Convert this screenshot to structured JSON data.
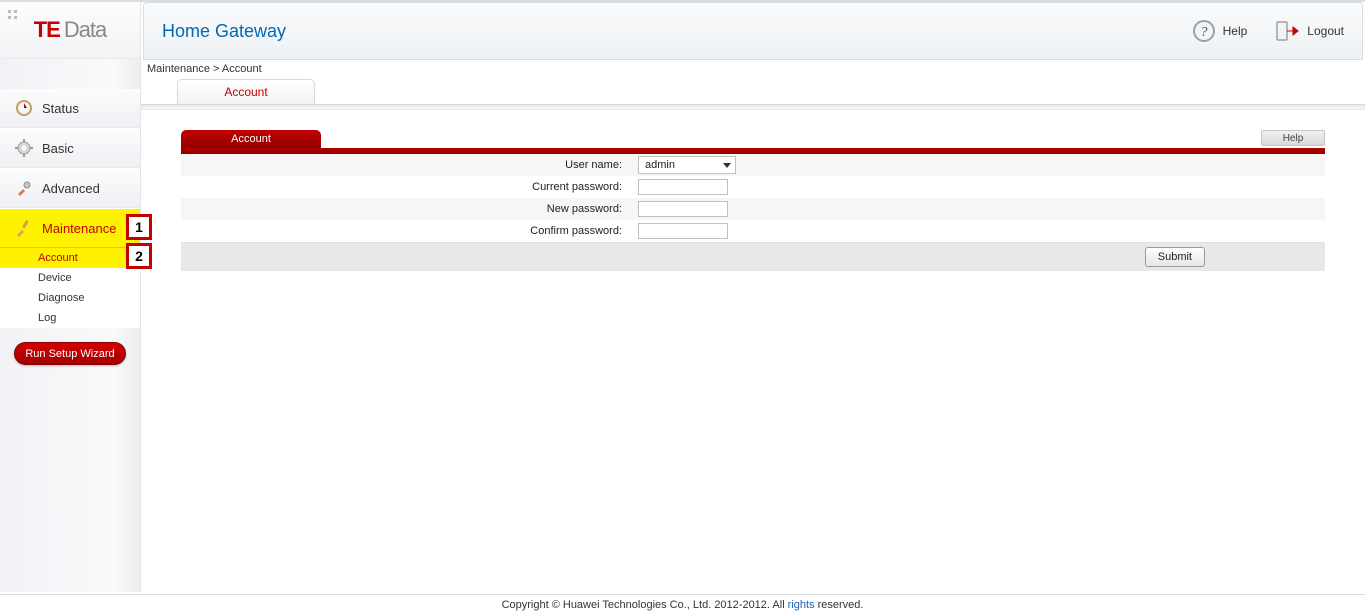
{
  "brand": {
    "te": "TE",
    "data": "Data"
  },
  "header": {
    "title": "Home Gateway",
    "help": "Help",
    "logout": "Logout"
  },
  "breadcrumbs": "Maintenance > Account",
  "page_tab": "Account",
  "sidebar": {
    "items": [
      {
        "label": "Status"
      },
      {
        "label": "Basic"
      },
      {
        "label": "Advanced"
      },
      {
        "label": "Maintenance"
      }
    ],
    "sub": [
      {
        "label": "Account"
      },
      {
        "label": "Device"
      },
      {
        "label": "Diagnose"
      },
      {
        "label": "Log"
      }
    ],
    "wizard": "Run Setup Wizard"
  },
  "callouts": {
    "one": "1",
    "two": "2"
  },
  "panel": {
    "tab": "Account",
    "help": "Help",
    "rows": {
      "username_label": "User name:",
      "username_value": "admin",
      "current_pw_label": "Current password:",
      "new_pw_label": "New password:",
      "confirm_pw_label": "Confirm password:"
    },
    "submit": "Submit"
  },
  "footer": {
    "prefix": "Copyright © Huawei Technologies Co., Ltd. 2012-2012. All",
    "rights": "rights",
    "suffix": "reserved."
  }
}
